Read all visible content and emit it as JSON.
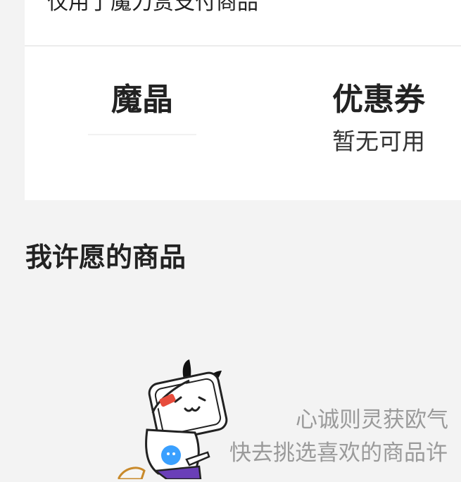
{
  "top_card": {
    "text": "仅用了魔力赏支付商品"
  },
  "tabs": [
    {
      "label": "魔晶",
      "sub": ""
    },
    {
      "label": "优惠券",
      "sub": "暂无可用"
    }
  ],
  "section": {
    "title": "我许愿的商品"
  },
  "empty_state": {
    "line1": "心诚则灵获欧气",
    "line2": "快去挑选喜欢的商品许",
    "illustration": "bilibili-tv-mascot-illustration"
  },
  "colors": {
    "page_bg": "#f3f3f3",
    "card_bg": "#ffffff",
    "muted_text": "#9a9a9a",
    "accent_purple": "#6a3fb8",
    "mascot_blue": "#3aa0ff"
  }
}
